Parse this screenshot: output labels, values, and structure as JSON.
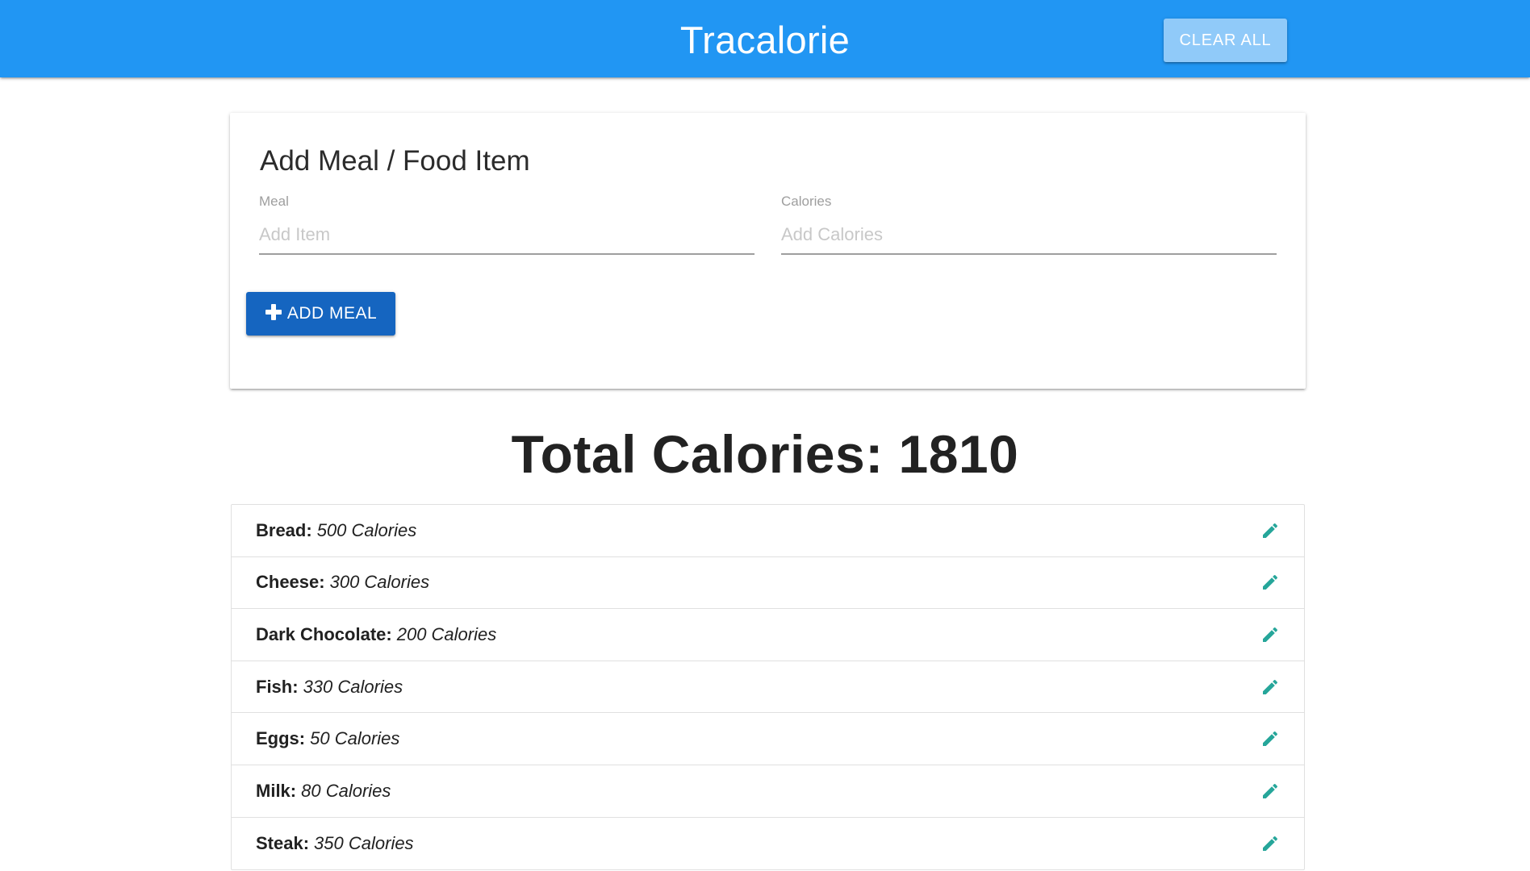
{
  "navbar": {
    "brand": "Tracalorie",
    "clear_all_label": "CLEAR ALL"
  },
  "form": {
    "title": "Add Meal / Food Item",
    "meal": {
      "label": "Meal",
      "placeholder": "Add Item",
      "value": ""
    },
    "calories": {
      "label": "Calories",
      "placeholder": "Add Calories",
      "value": ""
    },
    "add_button_label": "ADD MEAL"
  },
  "total": {
    "text": "Total Calories: 1810"
  },
  "items": [
    {
      "name": "Bread:",
      "calories": "500 Calories"
    },
    {
      "name": "Cheese:",
      "calories": "300 Calories"
    },
    {
      "name": "Dark Chocolate:",
      "calories": "200 Calories"
    },
    {
      "name": "Fish:",
      "calories": "330 Calories"
    },
    {
      "name": "Eggs:",
      "calories": "50 Calories"
    },
    {
      "name": "Milk:",
      "calories": "80 Calories"
    },
    {
      "name": "Steak:",
      "calories": "350 Calories"
    }
  ],
  "icons": {
    "add": "plus-icon",
    "edit": "pencil-icon"
  },
  "colors": {
    "navbar": "#2196f3",
    "clear_button": "#90caf9",
    "add_button": "#1565c0",
    "edit_icon": "#26a69a"
  }
}
